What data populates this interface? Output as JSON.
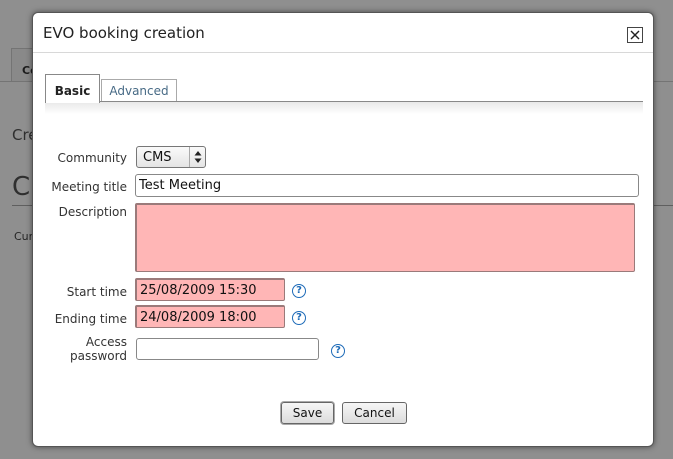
{
  "background": {
    "tab_label": "Co",
    "heading_small": "Cre",
    "heading_large": "Cr",
    "text_small": "Cur"
  },
  "dialog": {
    "title": "EVO booking creation",
    "tabs": [
      {
        "label": "Basic",
        "active": true
      },
      {
        "label": "Advanced",
        "active": false
      }
    ],
    "form": {
      "community_label": "Community",
      "community_value": "CMS",
      "meeting_title_label": "Meeting title",
      "meeting_title_value": "Test Meeting",
      "description_label": "Description",
      "description_value": "",
      "start_time_label": "Start time",
      "start_time_value": "25/08/2009 15:30",
      "ending_time_label": "Ending time",
      "ending_time_value": "24/08/2009 18:00",
      "access_password_label_line1": "Access",
      "access_password_label_line2": "password",
      "access_password_value": ""
    },
    "help_glyph": "?",
    "buttons": {
      "save": "Save",
      "cancel": "Cancel"
    },
    "colors": {
      "error_field_bg": "#ffb6b6",
      "help_icon": "#1e6bb8",
      "link_tab": "#476a85"
    }
  }
}
